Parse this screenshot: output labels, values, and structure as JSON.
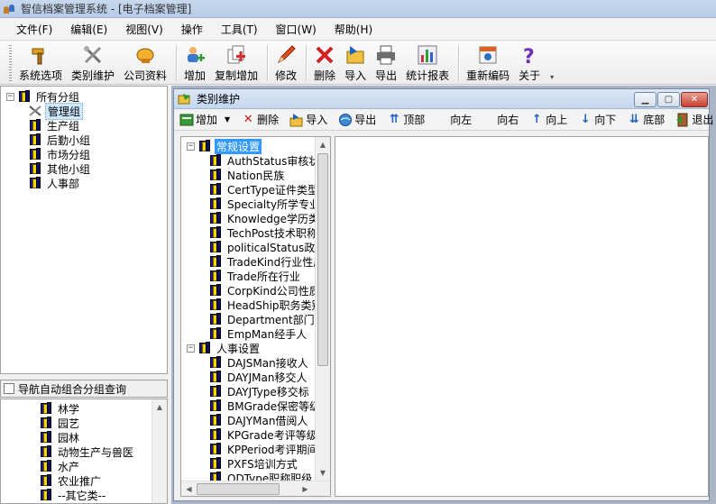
{
  "window": {
    "title": "智信档案管理系统 - [电子档案管理]"
  },
  "menu": [
    "文件(F)",
    "编辑(E)",
    "视图(V)",
    "操作",
    "工具(T)",
    "窗口(W)",
    "帮助(H)"
  ],
  "toolbar": {
    "options": "系统选项",
    "category": "类别维护",
    "company": "公司资料",
    "add": "增加",
    "copy_add": "复制增加",
    "edit": "修改",
    "delete": "删除",
    "import": "导入",
    "export": "导出",
    "report": "统计报表",
    "renumber": "重新编码",
    "about": "关于"
  },
  "left_tree": {
    "root": "所有分组",
    "items": [
      "管理组",
      "生产组",
      "后勤小组",
      "市场分组",
      "其他小组",
      "人事部"
    ]
  },
  "nav_checkbox": "导航自动组合分组查询",
  "bottom_list": [
    "林学",
    "园艺",
    "园林",
    "动物生产与兽医",
    "水产",
    "农业推广",
    "--其它类--"
  ],
  "child_window": {
    "title": "类别维护",
    "toolbar": {
      "add": "增加",
      "delete": "删除",
      "import": "导入",
      "export": "导出",
      "top": "顶部",
      "left": "向左",
      "right": "向右",
      "up": "向上",
      "down": "向下",
      "bottom": "底部",
      "exit": "退出"
    },
    "tree": {
      "group1": "常规设置",
      "group1_items": [
        "AuthStatus审核状",
        "Nation民族",
        "CertType证件类型",
        "Specialty所学专业",
        "Knowledge学历类",
        "TechPost技术职称",
        "politicalStatus政治",
        "TradeKind行业性质",
        "Trade所在行业",
        "CorpKind公司性质",
        "HeadShip职务类别",
        "Department部门类",
        "EmpMan经手人"
      ],
      "group2": "人事设置",
      "group2_items": [
        "DAJSMan接收人",
        "DAYJMan移交人",
        "DAYJType移交标",
        "BMGrade保密等级",
        "DAJYMan借阅人",
        "KPGrade考评等级",
        "KPPeriod考评期间",
        "PXFS培训方式",
        "ODType职称职级"
      ]
    }
  },
  "colors": {
    "accent": "#3399ff",
    "mdi_bg": "#abb5c6",
    "title_bg": "#c4d6ee"
  }
}
